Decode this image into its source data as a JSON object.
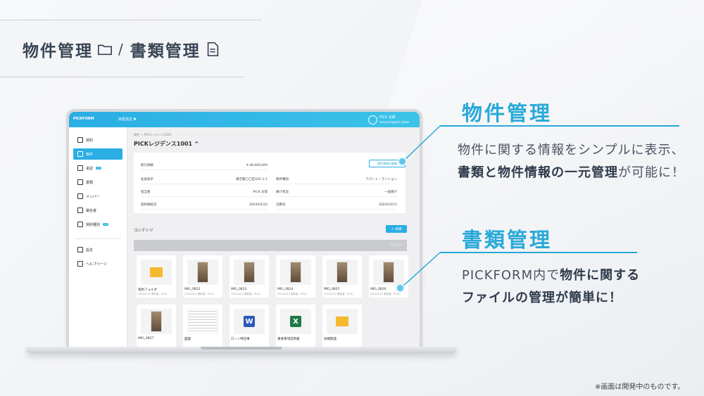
{
  "banner": {
    "part1": "物件管理",
    "slash": "/",
    "part2": "書類管理"
  },
  "app": {
    "logo": "PICKFORM",
    "org": "目黒支店 ▼",
    "user_name": "PICK 太郎",
    "user_mail": "taro.pick@pick.sakon"
  },
  "sidebar": {
    "items": [
      {
        "label": "契約"
      },
      {
        "label": "物件"
      },
      {
        "label": "承認",
        "badge": "20"
      },
      {
        "label": "書類"
      },
      {
        "label": "メンバー"
      },
      {
        "label": "署名者"
      },
      {
        "label": "契約種別",
        "badge": "20"
      },
      {
        "label": "設定"
      },
      {
        "label": "ヘルプページ"
      }
    ]
  },
  "main": {
    "breadcrumb": "物件 ＞ PICKレジデンス1001",
    "title": "PICKレジデンス1001 ^",
    "edit_button": "物件情報の編集",
    "fields": [
      {
        "label": "取引価格",
        "value": "¥ 48,000,000"
      },
      {
        "label": "住居表示",
        "value": "東京都〇〇区XX1-1-1"
      },
      {
        "label": "物件種別",
        "value": "アパート・マンション"
      },
      {
        "label": "担当者",
        "value": "PICK 太郎"
      },
      {
        "label": "媒介状況",
        "value": "一般媒介"
      },
      {
        "label": "契約締結日",
        "value": "2024/02/24"
      },
      {
        "label": "決算日",
        "value": "2024/03/15"
      }
    ],
    "contents_label": "コンテンツ",
    "new_button": "＋ 新規",
    "view_mode": "アイコン",
    "tiles": [
      {
        "name": "契約フォルダ",
        "meta": "2024/3/12 更新者：PICK..."
      },
      {
        "name": "IMG_0822",
        "meta": "2024/3/12 更新者：PICK..."
      },
      {
        "name": "IMG_0823",
        "meta": "2024/3/12 更新者：PICK..."
      },
      {
        "name": "IMG_0824",
        "meta": "2024/3/12 更新者：PICK..."
      },
      {
        "name": "IMG_0825",
        "meta": "2024/3/12 更新者：PICK..."
      },
      {
        "name": "IMG_0826",
        "meta": "2024/3/12 更新者：PICK..."
      },
      {
        "name": "IMG_0827",
        "meta": ""
      },
      {
        "name": "図面",
        "meta": ""
      },
      {
        "name": "ローン特記事",
        "meta": ""
      },
      {
        "name": "重要事項説明書",
        "meta": ""
      },
      {
        "name": "詳細関連",
        "meta": ""
      }
    ]
  },
  "callout1": {
    "title": "物件管理",
    "line1": "物件に関する情報をシンプルに表示、",
    "line2_strong": "書類と物件情報の一元管理",
    "line2_rest": "が可能に！"
  },
  "callout2": {
    "title": "書類管理",
    "line1_pre": "PICKFORM内で",
    "line1_strong": "物件に関する",
    "line2_strong": "ファイルの管理が簡単に！"
  },
  "footnote": "※画面は開発中のものです。",
  "colors": {
    "accent": "#29a9d8",
    "header": "#2aaee4"
  }
}
